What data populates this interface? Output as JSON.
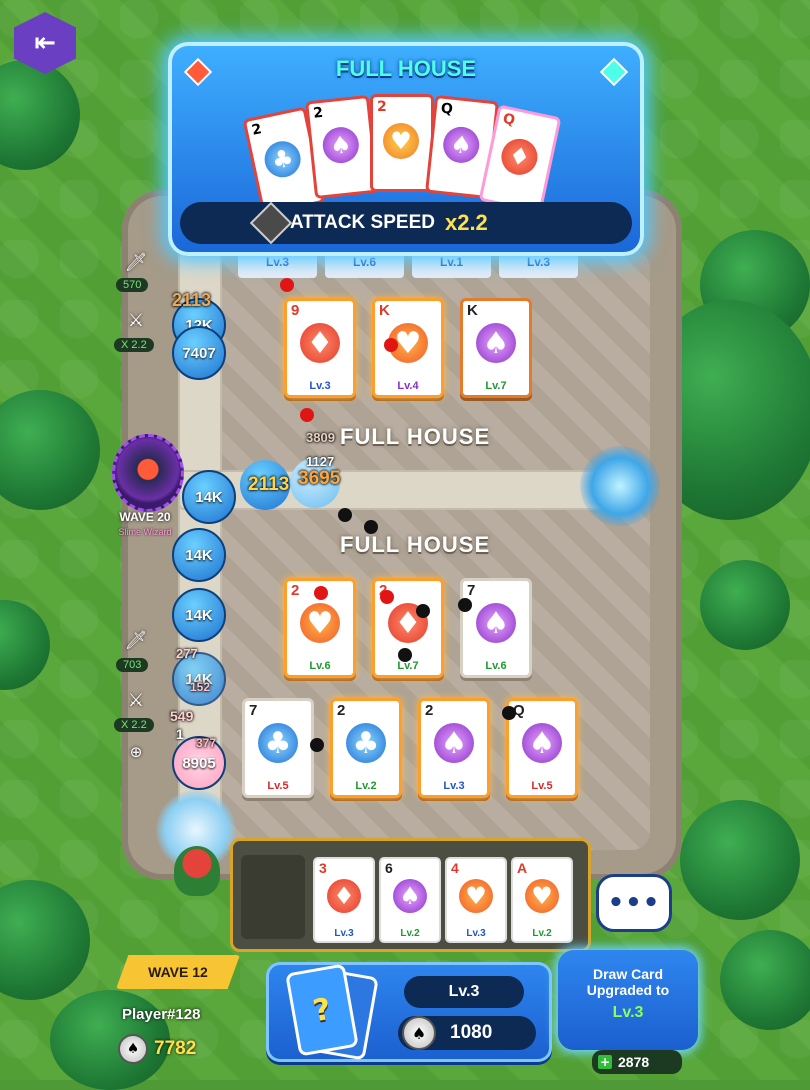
{
  "popup": {
    "title": "FULL HOUSE",
    "effect_label": "ATTACK SPEED",
    "effect_multiplier": "x2.2",
    "cards": [
      {
        "rank": "2",
        "suit": "club",
        "color": "blue"
      },
      {
        "rank": "2",
        "suit": "spade",
        "color": "purple"
      },
      {
        "rank": "2",
        "suit": "heart",
        "color": "red"
      },
      {
        "rank": "Q",
        "suit": "spade",
        "color": "purple"
      },
      {
        "rank": "Q",
        "suit": "diamond",
        "color": "red"
      }
    ]
  },
  "top_lv_bar": [
    "Lv.3",
    "Lv.6",
    "Lv.1",
    "Lv.3"
  ],
  "top_board": {
    "banner": "FULL HOUSE",
    "cards": [
      {
        "rank": "9",
        "symbol": "♦",
        "lv": "Lv.3"
      },
      {
        "rank": "K",
        "symbol": "♥",
        "lv": "Lv.4"
      },
      {
        "rank": "K",
        "symbol": "♠",
        "lv": "Lv.7"
      }
    ]
  },
  "bottom_board": {
    "banner": "FULL HOUSE",
    "row1": [
      {
        "rank": "2",
        "symbol": "♥",
        "lv": "Lv.6"
      },
      {
        "rank": "2",
        "symbol": "♦",
        "lv": "Lv.7"
      },
      {
        "rank": "7",
        "symbol": "♠",
        "lv": "Lv.6"
      }
    ],
    "row2": [
      {
        "rank": "7",
        "symbol": "♣",
        "lv": "Lv.5"
      },
      {
        "rank": "2",
        "symbol": "♣",
        "lv": "Lv.2"
      },
      {
        "rank": "2",
        "symbol": "♠",
        "lv": "Lv.3"
      },
      {
        "rank": "Q",
        "symbol": "♠",
        "lv": "Lv.5"
      }
    ]
  },
  "left_stats": {
    "top_power": "570",
    "top_speed": "X 2.2",
    "bottom_power": "703",
    "bottom_speed": "X 2.2"
  },
  "boss": {
    "wave": "WAVE 20",
    "name": "Slime Wizard"
  },
  "enemies": [
    "12K",
    "7407",
    "14K",
    "14K",
    "14K",
    "14K",
    "8905"
  ],
  "damage_numbers": [
    "2113",
    "2113",
    "3695",
    "1127",
    "3809",
    "549",
    "277",
    "152",
    "1",
    "377"
  ],
  "hand": [
    {
      "rank": "3",
      "symbol": "♦",
      "lv": "Lv.3"
    },
    {
      "rank": "6",
      "symbol": "♠",
      "lv": "Lv.2"
    },
    {
      "rank": "4",
      "symbol": "♥",
      "lv": "Lv.3"
    },
    {
      "rank": "A",
      "symbol": "♥",
      "lv": "Lv.2"
    }
  ],
  "player": {
    "wave": "WAVE 12",
    "name": "Player#128",
    "coins": "7782"
  },
  "draw_panel": {
    "level": "Lv.3",
    "cost": "1080",
    "deck_symbol": "?"
  },
  "upgrade_bubble": {
    "line1": "Draw Card",
    "line2": "Upgraded to",
    "level": "Lv.3"
  },
  "bottom_counter": "2878",
  "icons": {
    "exit": "exit-icon",
    "chat": "chat-bubble-icon",
    "coin": "coin-icon",
    "zoom": "zoom-icon"
  }
}
